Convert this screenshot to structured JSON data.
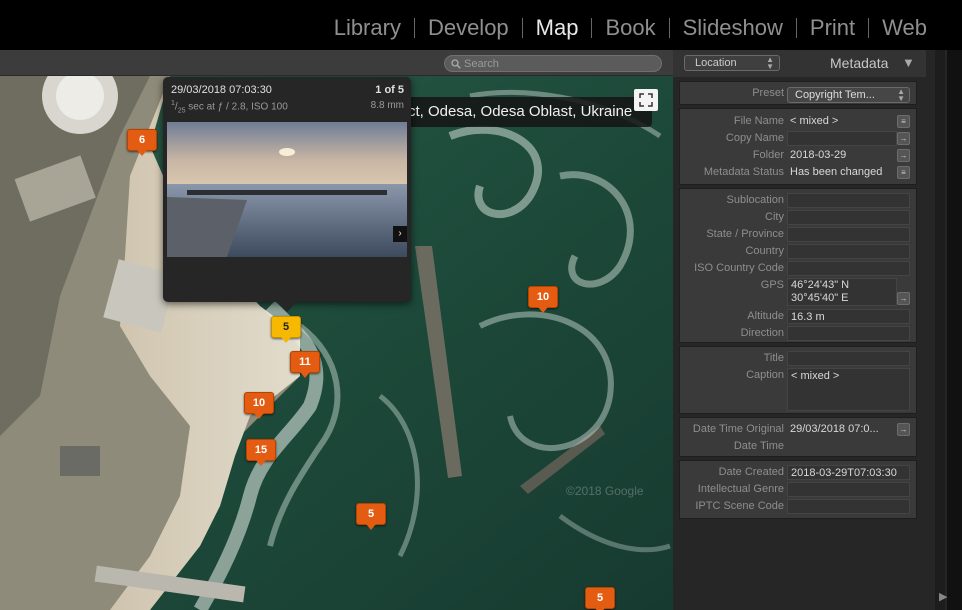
{
  "modules": [
    "Library",
    "Develop",
    "Map",
    "Book",
    "Slideshow",
    "Print",
    "Web"
  ],
  "active_module": "Map",
  "search": {
    "placeholder": "Search"
  },
  "map": {
    "location_label": "ct, Odesa, Odesa Oblast, Ukraine",
    "watermark": "©2018 Google",
    "markers": [
      "6",
      "10",
      "5",
      "11",
      "10",
      "15",
      "5",
      "5"
    ]
  },
  "popup": {
    "date": "29/03/2018 07:03:30",
    "count": "1 of 5",
    "exposure_num": "1",
    "exposure_den": "25",
    "exposure_rest": " sec at ƒ / 2.8, ISO 100",
    "focal": "8.8 mm"
  },
  "panel": {
    "location_select": "Location",
    "title": "Metadata",
    "preset": {
      "label": "Preset",
      "value": "Copyright Tem..."
    },
    "file": {
      "file_name": {
        "label": "File Name",
        "value": "< mixed >"
      },
      "copy_name": {
        "label": "Copy Name",
        "value": ""
      },
      "folder": {
        "label": "Folder",
        "value": "2018-03-29"
      },
      "metadata_status": {
        "label": "Metadata Status",
        "value": "Has been changed"
      }
    },
    "location": {
      "sublocation": {
        "label": "Sublocation",
        "value": ""
      },
      "city": {
        "label": "City",
        "value": ""
      },
      "state": {
        "label": "State / Province",
        "value": ""
      },
      "country": {
        "label": "Country",
        "value": ""
      },
      "iso": {
        "label": "ISO Country Code",
        "value": ""
      },
      "gps": {
        "label": "GPS",
        "lat": "46°24'43\" N",
        "lon": "30°45'40\" E"
      },
      "altitude": {
        "label": "Altitude",
        "value": "16.3 m"
      },
      "direction": {
        "label": "Direction",
        "value": ""
      }
    },
    "text": {
      "title": {
        "label": "Title",
        "value": ""
      },
      "caption": {
        "label": "Caption",
        "value": "< mixed >"
      }
    },
    "dates": {
      "dto": {
        "label": "Date Time Original",
        "value": "29/03/2018 07:0..."
      },
      "dt": {
        "label": "Date Time",
        "value": ""
      }
    },
    "misc": {
      "date_created": {
        "label": "Date Created",
        "value": "2018-03-29T07:03:30"
      },
      "genre": {
        "label": "Intellectual Genre",
        "value": ""
      },
      "scene": {
        "label": "IPTC Scene Code",
        "value": ""
      }
    }
  },
  "colors": {
    "marker": "#e35c12",
    "marker_selected": "#f6b800",
    "sea": "#1f4a3b",
    "panel_bg": "#262626"
  }
}
